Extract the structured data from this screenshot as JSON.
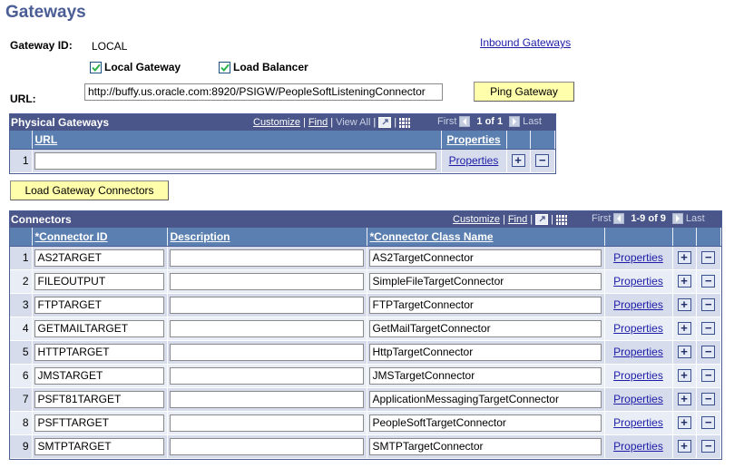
{
  "page": {
    "title": "Gateways"
  },
  "gateway": {
    "id_label": "Gateway ID:",
    "id_value": "LOCAL",
    "inbound_link": "Inbound Gateways",
    "local_gateway": {
      "label": "Local Gateway",
      "checked": true
    },
    "load_balancer": {
      "label": "Load Balancer",
      "checked": true
    },
    "url_label": "URL:",
    "url_value": "http://buffy.us.oracle.com:8920/PSIGW/PeopleSoftListeningConnector",
    "ping_button": "Ping Gateway",
    "load_connectors_button": "Load Gateway Connectors"
  },
  "physical_gateways": {
    "title": "Physical Gateways",
    "tools": {
      "customize": "Customize",
      "find": "Find",
      "view_all": "View All"
    },
    "nav": {
      "first": "First",
      "count": "1 of 1",
      "last": "Last"
    },
    "columns": {
      "url": "URL",
      "properties": "Properties"
    },
    "rows": [
      {
        "num": "1",
        "url": "",
        "properties": "Properties"
      }
    ]
  },
  "connectors": {
    "title": "Connectors",
    "tools": {
      "customize": "Customize",
      "find": "Find"
    },
    "nav": {
      "first": "First",
      "count": "1-9 of 9",
      "last": "Last"
    },
    "columns": {
      "id": "*Connector ID",
      "description": "Description",
      "class_name": "*Connector Class Name"
    },
    "rows": [
      {
        "num": "1",
        "id": "AS2TARGET",
        "description": "",
        "class_name": "AS2TargetConnector",
        "properties": "Properties"
      },
      {
        "num": "2",
        "id": "FILEOUTPUT",
        "description": "",
        "class_name": "SimpleFileTargetConnector",
        "properties": "Properties"
      },
      {
        "num": "3",
        "id": "FTPTARGET",
        "description": "",
        "class_name": "FTPTargetConnector",
        "properties": "Properties"
      },
      {
        "num": "4",
        "id": "GETMAILTARGET",
        "description": "",
        "class_name": "GetMailTargetConnector",
        "properties": "Properties"
      },
      {
        "num": "5",
        "id": "HTTPTARGET",
        "description": "",
        "class_name": "HttpTargetConnector",
        "properties": "Properties"
      },
      {
        "num": "6",
        "id": "JMSTARGET",
        "description": "",
        "class_name": "JMSTargetConnector",
        "properties": "Properties"
      },
      {
        "num": "7",
        "id": "PSFT81TARGET",
        "description": "",
        "class_name": "ApplicationMessagingTargetConnector",
        "properties": "Properties"
      },
      {
        "num": "8",
        "id": "PSFTTARGET",
        "description": "",
        "class_name": "PeopleSoftTargetConnector",
        "properties": "Properties"
      },
      {
        "num": "9",
        "id": "SMTPTARGET",
        "description": "",
        "class_name": "SMTPTargetConnector",
        "properties": "Properties"
      }
    ]
  },
  "icons": {
    "add": "+",
    "remove": "−"
  },
  "colors": {
    "title": "#4a5d94",
    "grid_header": "#4a5689",
    "column_header": "#5a7fb0",
    "row_odd": "#d6dceb",
    "row_even": "#e9edf5",
    "button": "#fffeab",
    "link": "#1c1ca8"
  }
}
